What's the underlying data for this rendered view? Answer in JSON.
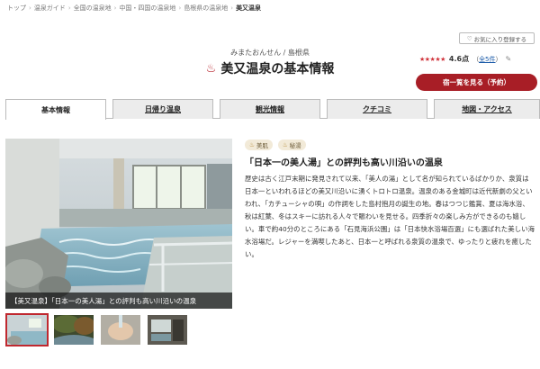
{
  "breadcrumb": [
    "トップ",
    "温泉ガイド",
    "全国の温泉地",
    "中国・四国の温泉地",
    "島根県の温泉地",
    "美又温泉"
  ],
  "header": {
    "kana_region": "みまたおんせん / 島根県",
    "title": "美又温泉の基本情報",
    "title_icon": "hot-spring-icon"
  },
  "actions": {
    "favorite_label": "お気に入り登録する",
    "rating_stars": "★★★★★",
    "rating_score": "4.6点",
    "rating_count_prefix": "（",
    "rating_count_link": "全5件",
    "rating_count_suffix": "）",
    "inn_list_label": "宿一覧を見る（予約）"
  },
  "tabs": [
    {
      "label": "基本情報",
      "active": true
    },
    {
      "label": "日帰り温泉",
      "active": false
    },
    {
      "label": "観光情報",
      "active": false
    },
    {
      "label": "クチコミ",
      "active": false
    },
    {
      "label": "地図・アクセス",
      "active": false
    }
  ],
  "photo": {
    "caption": "【美又温泉】「日本一の美人湯」との評判も高い川沿いの温泉"
  },
  "tags": [
    {
      "label": "美肌",
      "icon": "beauty-icon"
    },
    {
      "label": "秘湯",
      "icon": "hot-spring-icon"
    }
  ],
  "headline": "「日本一の美人湯」との評判も高い川沿いの温泉",
  "description": [
    "歴史は古く江戸末期に発見されて以来、「美人の湯」として名が知られているばかりか、泉質は日本一といわれるほどの美又川沿いに湧くトロトロ温泉。温泉のある金城町は近代新劇の父といわれ、「カチューシャの唄」の作詞をした島村抱月の誕生の地。春はつつじ鑑賞、夏は海水浴、秋は紅葉、冬はスキーに訪れる人々で賑わいを見せる。四季折々の楽しみ方ができるのも嬉しい。車で約40分のところにある「石見海浜公園」は「日本快水浴場百選」にも選ばれた美しい海水浴場だ。レジャーを満喫したあと、日本一と呼ばれる泉質の温泉で、ゆったりと疲れを癒したい。"
  ],
  "colors": {
    "accent": "#a81e26",
    "star": "#d0333b",
    "link": "#1a5aa8"
  }
}
